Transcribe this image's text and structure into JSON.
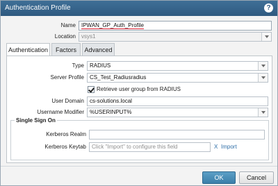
{
  "window": {
    "title": "Authentication Profile"
  },
  "form": {
    "name_label": "Name",
    "name_value": "IPWAN_GP_Auth_Profile",
    "location_label": "Location",
    "location_value": "vsys1"
  },
  "tabs": [
    {
      "label": "Authentication",
      "active": true
    },
    {
      "label": "Factors",
      "active": false
    },
    {
      "label": "Advanced",
      "active": false
    }
  ],
  "auth": {
    "type_label": "Type",
    "type_value": "RADIUS",
    "server_profile_label": "Server Profile",
    "server_profile_value": "CS_Test_Radiusradius",
    "retrieve_group_label": "Retrieve user group from RADIUS",
    "retrieve_group_checked": true,
    "user_domain_label": "User Domain",
    "user_domain_value": "cs-solutions.local",
    "username_modifier_label": "Username Modifier",
    "username_modifier_value": "%USERINPUT%"
  },
  "sso": {
    "title": "Single Sign On",
    "kerberos_realm_label": "Kerberos Realm",
    "kerberos_realm_value": "",
    "kerberos_keytab_label": "Kerberos Keytab",
    "kerberos_keytab_placeholder": "Click \"Import\" to configure this field",
    "clear_glyph": "X",
    "import_label": "Import"
  },
  "buttons": {
    "ok": "OK",
    "cancel": "Cancel"
  },
  "colors": {
    "titlebar": "#2f5a80",
    "ok_button": "#3b7fa9",
    "link": "#2f6fa8"
  }
}
